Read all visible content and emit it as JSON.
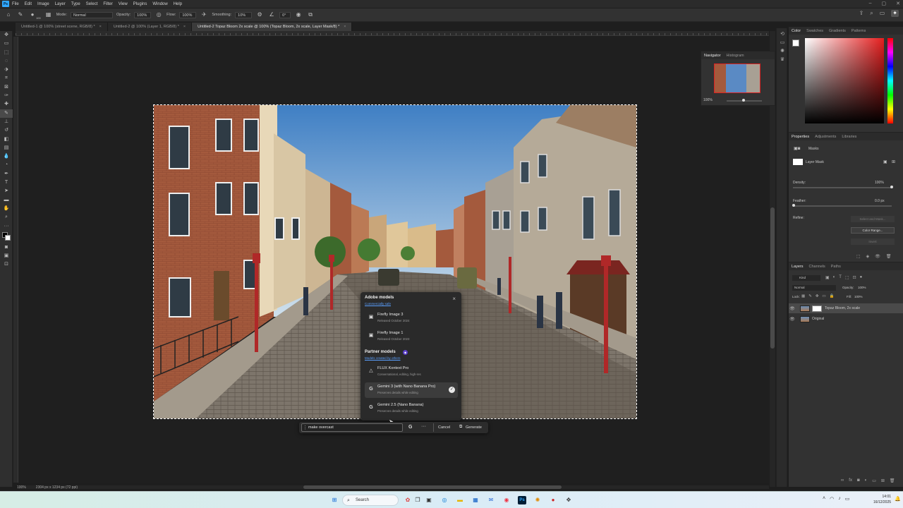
{
  "menu": [
    "File",
    "Edit",
    "Image",
    "Layer",
    "Type",
    "Select",
    "Filter",
    "View",
    "Plugins",
    "Window",
    "Help"
  ],
  "options": {
    "mode_label": "Mode:",
    "mode_value": "Normal",
    "opacity_label": "Opacity:",
    "opacity_value": "100%",
    "flow_label": "Flow:",
    "flow_value": "100%",
    "smoothing_label": "Smoothing:",
    "smoothing_value": "10%",
    "angle_value": "0°",
    "brush_size": "100"
  },
  "tabs": [
    {
      "label": "Untitled-1 @ 100% (street scene, RGB/8) *"
    },
    {
      "label": "Untitled-2 @ 100% (Layer 1, RGB/8) *"
    },
    {
      "label": "Untitled-2 Topaz Bloom 2x scale @ 100% (Topaz Bloom, 2x scale, Layer Mask/8) *"
    }
  ],
  "status": {
    "zoom": "100%",
    "dimensions": "2304 px x 1234 px (72 ppi)"
  },
  "navigator": {
    "tabs": [
      "Navigator",
      "Histogram"
    ],
    "zoom": "100%"
  },
  "color_panel": {
    "tabs": [
      "Color",
      "Swatches",
      "Gradients",
      "Patterns"
    ]
  },
  "properties": {
    "tabs": [
      "Properties",
      "Adjustments",
      "Libraries"
    ],
    "section": "Masks",
    "mask_label": "Layer Mask",
    "density_label": "Density:",
    "density_value": "100%",
    "feather_label": "Feather:",
    "feather_value": "0.0 px",
    "refine_label": "Refine:",
    "select_mask_btn": "Select and Mask...",
    "color_range_btn": "Color Range...",
    "invert_btn": "Invert"
  },
  "layers": {
    "tabs": [
      "Layers",
      "Channels",
      "Paths"
    ],
    "kind_label": "Kind",
    "blend": "Normal",
    "opacity_label": "Opacity:",
    "opacity_value": "100%",
    "lock_label": "Lock:",
    "fill_label": "Fill:",
    "fill_value": "100%",
    "items": [
      {
        "name": "Topaz Bloom, 2x scale"
      },
      {
        "name": "Original"
      }
    ]
  },
  "popup": {
    "adobe_title": "Adobe models",
    "adobe_sub": "Commercially safe",
    "adobe_models": [
      {
        "name": "Firefly Image 3",
        "desc": "Released October 2024"
      },
      {
        "name": "Firefly Image 1",
        "desc": "Released October 2023"
      }
    ],
    "partner_title": "Partner models",
    "partner_sub": "Models created by others",
    "partner_models": [
      {
        "name": "FLUX Kontext Pro",
        "desc": "Conversational, editing, high-res"
      },
      {
        "name": "Gemini 3 (with Nano Banana Pro)",
        "desc": "Preserves details while editing",
        "selected": true
      },
      {
        "name": "Gemini 2.5 (Nano Banana)",
        "desc": "Preserves details while editing"
      }
    ]
  },
  "genbar": {
    "prompt": "make overcast",
    "cancel": "Cancel",
    "generate": "Generate",
    "more": "···"
  },
  "taskbar": {
    "search": "Search",
    "time": "14:01",
    "date": "16/12/2025"
  }
}
